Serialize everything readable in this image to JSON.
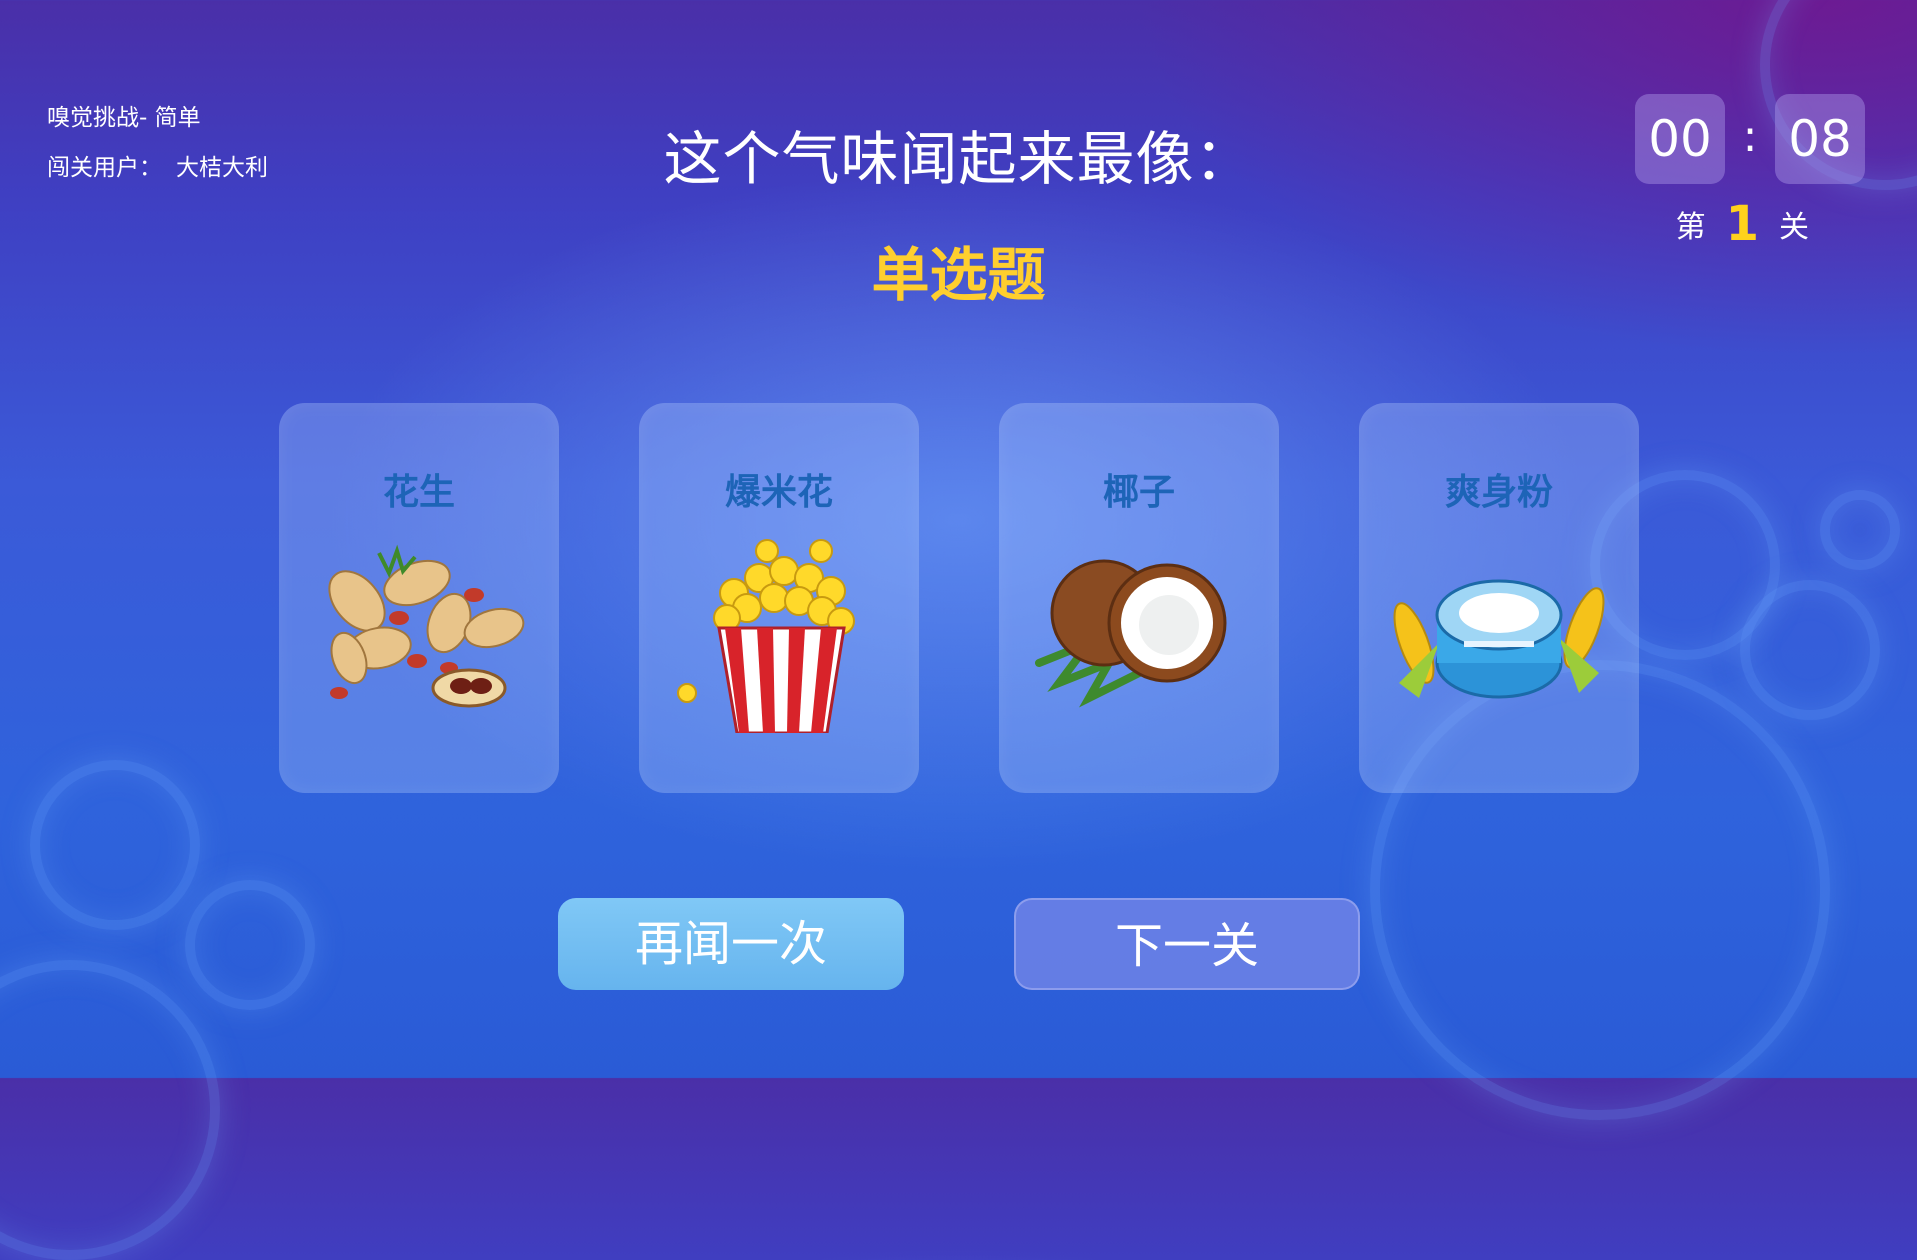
{
  "header": {
    "mode": "嗅觉挑战- 简单",
    "user_label": "闯关用户：",
    "user_name": "大桔大利",
    "question": "这个气味闻起来最像：",
    "question_type": "单选题"
  },
  "timer": {
    "minutes": "00",
    "separator": ":",
    "seconds": "08"
  },
  "level": {
    "prefix": "第",
    "number": "1",
    "suffix": "关"
  },
  "options": [
    {
      "label": "花生",
      "icon": "peanut-icon"
    },
    {
      "label": "爆米花",
      "icon": "popcorn-icon"
    },
    {
      "label": "椰子",
      "icon": "coconut-icon"
    },
    {
      "label": "爽身粉",
      "icon": "talcum-powder-icon"
    }
  ],
  "buttons": {
    "again": "再闻一次",
    "next": "下一关"
  },
  "colors": {
    "accent": "#ffcf2e",
    "option_label": "#1d64b7",
    "again_button": "#72bdf2",
    "next_button": "#6e82e6"
  }
}
